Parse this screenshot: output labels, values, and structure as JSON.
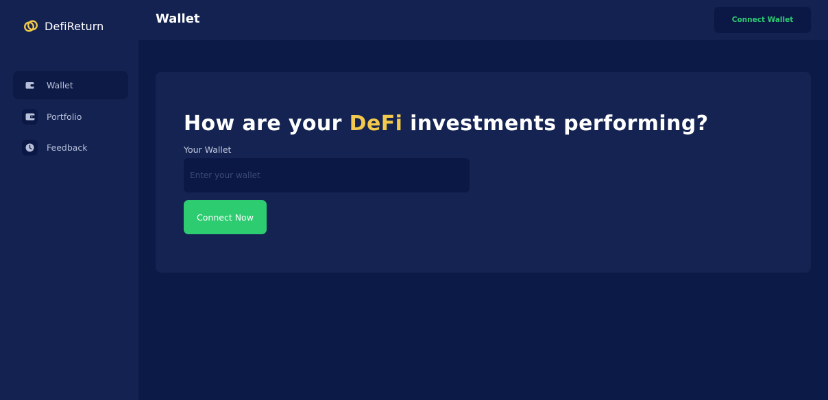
{
  "brand": {
    "name": "DefiReturn",
    "logo_icon": "linked-rings-icon",
    "logo_color": "#f2c94c"
  },
  "sidebar": {
    "items": [
      {
        "label": "Wallet",
        "icon": "wallet-icon",
        "active": true
      },
      {
        "label": "Portfolio",
        "icon": "portfolio-icon",
        "active": false
      },
      {
        "label": "Feedback",
        "icon": "clock-icon",
        "active": false
      }
    ]
  },
  "header": {
    "title": "Wallet",
    "connect_label": "Connect Wallet"
  },
  "main": {
    "headline_before": "How are your ",
    "headline_accent": "DeFi",
    "headline_after": " investments performing?",
    "field_label": "Your Wallet",
    "input_placeholder": "Enter your wallet",
    "input_value": "",
    "cta_label": "Connect Now"
  },
  "colors": {
    "background": "#0b1a47",
    "panel": "#132251",
    "accent_green": "#2ecc71",
    "accent_yellow": "#f2c94c"
  }
}
